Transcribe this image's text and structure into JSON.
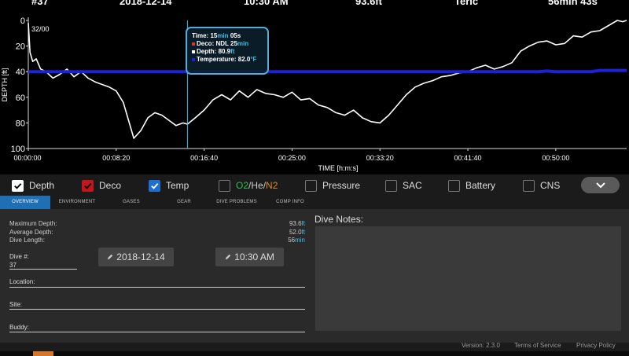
{
  "header": {
    "dive_number": "#37",
    "date": "2018-12-14",
    "time": "10:30 AM",
    "max_depth": "93.6ft",
    "buddy_name": "Teric",
    "duration": "56min 43s"
  },
  "chart_data": {
    "type": "line",
    "title": "",
    "xlabel": "TIME [h:m:s]",
    "ylabel": "DEPTH [ft]",
    "ylim": [
      100,
      0
    ],
    "y_ticks": [
      "0",
      "20",
      "40",
      "60",
      "80",
      "100"
    ],
    "x_ticks": [
      "00:00:00",
      "00:08:20",
      "00:16:40",
      "00:25:00",
      "00:33:20",
      "00:41:40",
      "00:50:00"
    ],
    "x_tick_seconds": [
      0,
      500,
      1000,
      1500,
      2000,
      2500,
      3000
    ],
    "xlim_seconds": [
      0,
      3403
    ],
    "ceiling_label": "32/00",
    "cursor_seconds": 905,
    "series": [
      {
        "name": "Depth",
        "color": "#ffffff",
        "x": [
          0,
          10,
          25,
          45,
          70,
          100,
          140,
          180,
          220,
          260,
          300,
          340,
          380,
          420,
          460,
          500,
          540,
          570,
          600,
          640,
          680,
          720,
          760,
          800,
          840,
          880,
          905,
          950,
          1000,
          1050,
          1100,
          1150,
          1200,
          1250,
          1300,
          1350,
          1400,
          1450,
          1500,
          1550,
          1600,
          1650,
          1700,
          1750,
          1800,
          1850,
          1900,
          1950,
          2000,
          2050,
          2100,
          2150,
          2200,
          2250,
          2300,
          2350,
          2400,
          2450,
          2500,
          2550,
          2600,
          2650,
          2700,
          2750,
          2800,
          2850,
          2900,
          2950,
          3000,
          3050,
          3100,
          3150,
          3200,
          3250,
          3300,
          3350,
          3380,
          3403
        ],
        "values": [
          2,
          25,
          32,
          30,
          38,
          40,
          45,
          42,
          38,
          44,
          40,
          45,
          48,
          50,
          52,
          55,
          64,
          78,
          92,
          86,
          76,
          72,
          74,
          78,
          82,
          80,
          81,
          76,
          70,
          62,
          58,
          62,
          55,
          60,
          54,
          57,
          58,
          60,
          56,
          62,
          61,
          66,
          68,
          72,
          74,
          70,
          76,
          79,
          80,
          74,
          66,
          58,
          52,
          49,
          47,
          44,
          43,
          41,
          40,
          37,
          35,
          38,
          36,
          33,
          24,
          20,
          17,
          16,
          19,
          18,
          12,
          13,
          9,
          8,
          4,
          0,
          1,
          0
        ]
      },
      {
        "name": "Temp",
        "color": "#1c22d8",
        "x": [
          0,
          100,
          300,
          600,
          900,
          1200,
          1500,
          1800,
          2100,
          2400,
          2700,
          2900,
          2950,
          3000,
          3200,
          3250,
          3403
        ],
        "values": [
          40,
          40,
          40,
          40,
          40,
          40,
          40,
          40,
          40,
          40,
          40,
          40,
          39.5,
          40,
          40,
          39,
          39
        ]
      }
    ],
    "grid": false,
    "legend": "bottom"
  },
  "tooltip": {
    "time_label": "Time:",
    "time_min": "15",
    "time_min_unit": "min",
    "time_sec": "05s",
    "deco_label": "Deco:",
    "deco_value": "NDL 25",
    "deco_unit": "min",
    "depth_label": "Depth:",
    "depth_value": "80.9",
    "depth_unit": "ft",
    "temp_label": "Temperature:",
    "temp_value": "82.0",
    "temp_unit": "°F",
    "deco_color": "#e03030",
    "depth_color": "#ffffff",
    "temp_color": "#1c22d8"
  },
  "legend": {
    "items": [
      {
        "label": "Depth",
        "checked": true,
        "color": "#ffffff"
      },
      {
        "label": "Deco",
        "checked": true,
        "color": "#c0161c"
      },
      {
        "label": "Temp",
        "checked": true,
        "color": "#1d6fd0"
      },
      {
        "label_o2": "O2",
        "label_he": "He",
        "label_n2": "N2",
        "sep": "/",
        "checked": false
      },
      {
        "label": "Pressure",
        "checked": false
      },
      {
        "label": "SAC",
        "checked": false
      },
      {
        "label": "Battery",
        "checked": false
      },
      {
        "label": "CNS",
        "checked": false
      }
    ],
    "o2_color": "#2fbf4c",
    "he_color": "#d0d0d0",
    "n2_color": "#e08a1e",
    "expand_icon": "chevron-down-icon"
  },
  "tabs": [
    "OVERVIEW",
    "ENVIRONMENT",
    "GASES",
    "GEAR",
    "DIVE PROBLEMS",
    "COMP INFO"
  ],
  "overview": {
    "max_depth_label": "Maximum Depth:",
    "max_depth_value": "93.6",
    "max_depth_unit": "ft",
    "avg_depth_label": "Average Depth:",
    "avg_depth_value": "52.0",
    "avg_depth_unit": "ft",
    "length_label": "Dive Length:",
    "length_value": "56",
    "length_unit": "min",
    "dive_num_label": "Dive #:",
    "dive_num_value": "37",
    "date_button": "2018-12-14",
    "time_button": "10:30 AM",
    "location_label": "Location:",
    "site_label": "Site:",
    "buddy_label": "Buddy:"
  },
  "notes": {
    "title": "Dive Notes:"
  },
  "footer": {
    "version": "Version: 2.3.0",
    "terms": "Terms of Service",
    "privacy": "Privacy Policy"
  }
}
